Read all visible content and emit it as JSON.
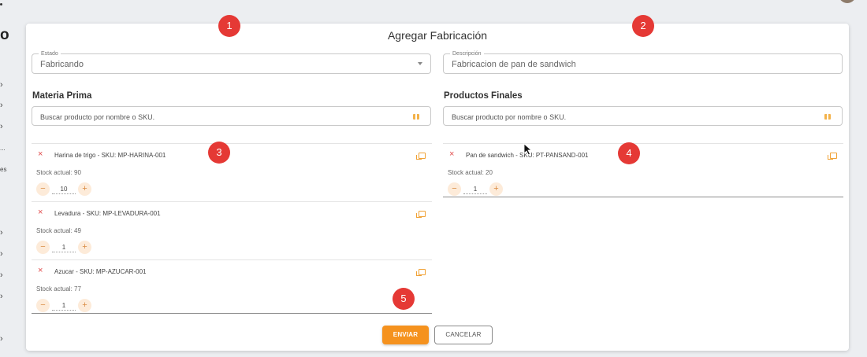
{
  "sidebar": {
    "letter": "o",
    "truncated_text_1": "...",
    "truncated_text_2": "es"
  },
  "modal": {
    "title": "Agregar Fabricación",
    "estado": {
      "label": "Estado",
      "value": "Fabricando"
    },
    "descripcion": {
      "label": "Descripción",
      "value": "Fabricacion de pan de sandwich"
    },
    "materia_prima": {
      "title": "Materia Prima",
      "search_placeholder": "Buscar producto por nombre o SKU.",
      "items": [
        {
          "name": "Harina de trigo - SKU: MP-HARINA-001",
          "stock": "Stock actual: 90",
          "qty": "10"
        },
        {
          "name": "Levadura - SKU: MP-LEVADURA-001",
          "stock": "Stock actual: 49",
          "qty": "1"
        },
        {
          "name": "Azucar - SKU: MP-AZUCAR-001",
          "stock": "Stock actual: 77",
          "qty": "1"
        }
      ]
    },
    "productos_finales": {
      "title": "Productos Finales",
      "search_placeholder": "Buscar producto por nombre o SKU.",
      "items": [
        {
          "name": "Pan de sandwich - SKU: PT-PANSAND-001",
          "stock": "Stock actual: 20",
          "qty": "1"
        }
      ]
    },
    "buttons": {
      "send": "ENVIAR",
      "cancel": "CANCELAR"
    }
  },
  "markers": [
    "1",
    "2",
    "3",
    "4",
    "5"
  ],
  "icons": {
    "remove": "×",
    "minus": "−",
    "plus": "+",
    "search": "grid-search-icon",
    "copy": "copy-icon"
  },
  "colors": {
    "accent": "#f5921e",
    "marker": "#e53935",
    "remove": "#e14b4b"
  }
}
